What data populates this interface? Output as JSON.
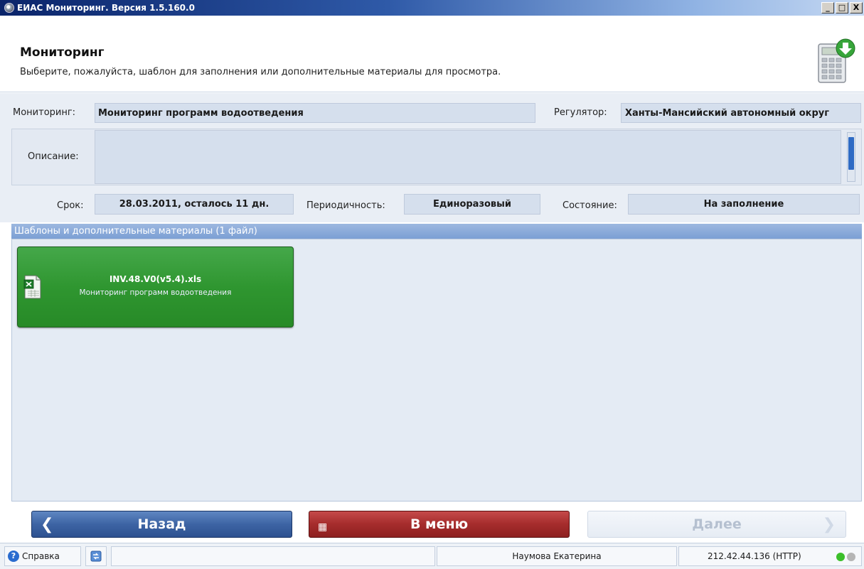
{
  "window": {
    "title": "ЕИАС Мониторинг. Версия 1.5.160.0",
    "min_label": "_",
    "max_label": "□",
    "close_label": "X"
  },
  "header": {
    "title": "Мониторинг",
    "subtitle": "Выберите, пожалуйста, шаблон для заполнения или дополнительные материалы для просмотра.",
    "icon": "calculator-download-icon"
  },
  "form": {
    "monitoring_label": "Мониторинг:",
    "monitoring_value": "Мониторинг программ водоотведения",
    "regulator_label": "Регулятор:",
    "regulator_value": "Ханты-Мансийский автономный округ",
    "description_label": "Описание:",
    "description_value": "",
    "deadline_label": "Срок:",
    "deadline_value": "28.03.2011, осталось 11 дн.",
    "periodicity_label": "Периодичность:",
    "periodicity_value": "Единоразовый",
    "state_label": "Состояние:",
    "state_value": "На заполнение"
  },
  "files": {
    "header": "Шаблоны и дополнительные материалы (1 файл)",
    "items": [
      {
        "name": "INV.48.V0(v5.4).xls",
        "description": "Мониторинг программ водоотведения",
        "icon": "excel-file-icon"
      }
    ]
  },
  "nav": {
    "back_label": "Назад",
    "menu_label": "В меню",
    "next_label": "Далее"
  },
  "statusbar": {
    "help_label": "Справка",
    "user": "Наумова Екатерина",
    "server": "212.42.44.136 (HTTP)"
  },
  "colors": {
    "accent_blue": "#3d64a4",
    "menu_red": "#a52c2c",
    "tile_green": "#2f9630",
    "status_green": "#3bbf2a",
    "status_grey": "#b5b5b5"
  }
}
